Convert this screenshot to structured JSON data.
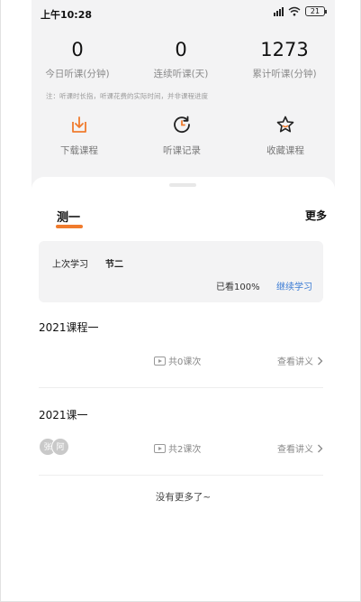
{
  "status_bar": {
    "time": "上午10:28",
    "battery": "21"
  },
  "stats": [
    {
      "value": "0",
      "label": "今日听课(分钟)"
    },
    {
      "value": "0",
      "label": "连续听课(天)"
    },
    {
      "value": "1273",
      "label": "累计听课(分钟)"
    }
  ],
  "note": "注：听课时长指，听课花费的实际时间，并非课程进度",
  "quick_actions": [
    {
      "label": "下载课程",
      "icon": "download-icon"
    },
    {
      "label": "听课记录",
      "icon": "history-icon"
    },
    {
      "label": "收藏课程",
      "icon": "star-icon"
    }
  ],
  "colors": {
    "accent": "#f07b2d",
    "link": "#3b7bd4",
    "panel_bg": "#f3f3f4"
  },
  "tab": {
    "label": "测一"
  },
  "more_label": "更多",
  "resume": {
    "label": "上次学习",
    "section": "节二",
    "progress": "已看100%",
    "continue_label": "继续学习"
  },
  "courses": [
    {
      "title": "2021课程一",
      "count": "共0课次",
      "handout": "查看讲义",
      "avatars": []
    },
    {
      "title": "2021课一",
      "count": "共2课次",
      "handout": "查看讲义",
      "avatars": [
        "张",
        "阿"
      ]
    }
  ],
  "footer": "没有更多了~"
}
